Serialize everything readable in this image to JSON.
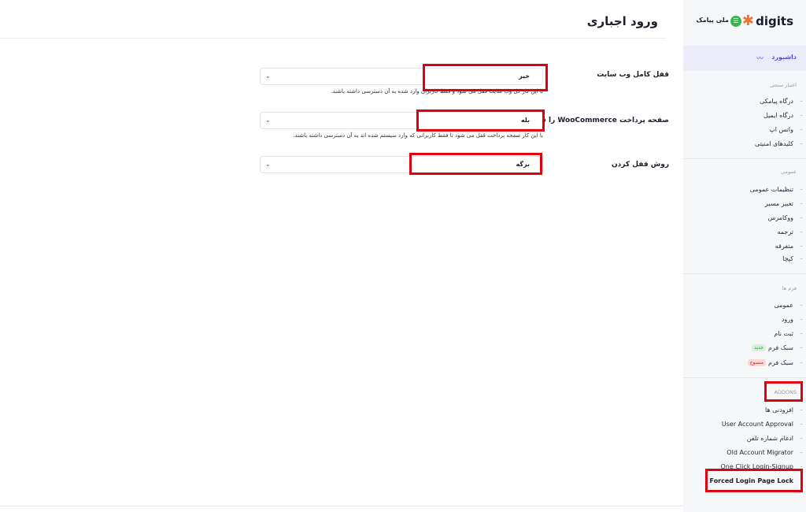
{
  "page": {
    "title": "ورود اجباری"
  },
  "settings": [
    {
      "label": "قفل کامل وب سایت",
      "value": "خیر",
      "help": "با این کار کل وب سایت قفل می شود و فقط کاربران وارد شده به آن دسترسی داشته باشند."
    },
    {
      "label": "صفحه پرداخت WooCommerce را قفل کنید",
      "value": "بله",
      "help": "با این کار صفحه پرداخت قفل می شود تا فقط کاربرانی که وارد سیستم شده اند به آن دسترسی داشته باشند."
    },
    {
      "label": "روش قفل کردن",
      "value": "برگه",
      "help": ""
    }
  ],
  "icons": {
    "chevron": "chevron-down-icon",
    "dashboard": "chart-wave-icon",
    "brand": "asterisk-icon",
    "melli": "chat-bubble-icon",
    "item": "dash-icon"
  },
  "sidebar": {
    "brand_name": "digits",
    "partner_name": "ملی پیامک",
    "dashboard": "داشبورد",
    "sections": [
      {
        "heading": "اعتبار سنجی",
        "items": [
          "درگاه پیامکی",
          "درگاه ایمیل",
          "واتس اپ",
          "کلیدهای امنیتی"
        ]
      },
      {
        "heading": "عمومی",
        "items": [
          "تنظیمات عمومی",
          "تغییر مسیر",
          "ووکامرس",
          "ترجمه",
          "متفرقه",
          "کپچا"
        ]
      },
      {
        "heading": "فرم ها",
        "items": [
          "عمومی",
          "ورود",
          "ثبت نام",
          "سبک فرم",
          "سبک فرم"
        ]
      },
      {
        "heading": "ADDONS",
        "items": [
          "افزودنی ها",
          "User Account Approval",
          "ادغام شماره تلفن",
          "Old Account Migrator",
          "One Click Login-Signup",
          "Forced Login Page Lock"
        ]
      }
    ],
    "badges": {
      "new": "جدید",
      "legacy": "منسوخ"
    }
  },
  "colors": {
    "accent": "#5b4bd6",
    "highlight": "#e0000f",
    "brand_orange": "#f3712a",
    "melli_green": "#3ab54a"
  }
}
